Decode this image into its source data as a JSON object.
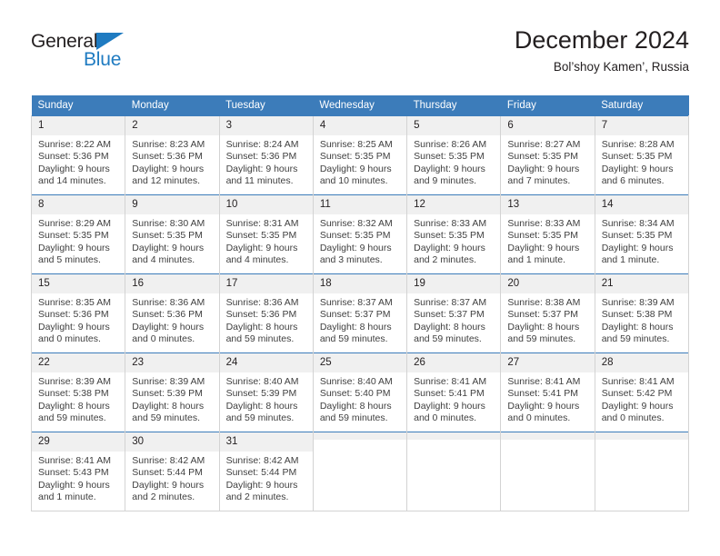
{
  "brand": {
    "name_part1": "General",
    "name_part2": "Blue",
    "triangle_icon": "triangle-logo-mark",
    "accent_color": "#1f7bc1",
    "text_color": "#231f20"
  },
  "header": {
    "title": "December 2024",
    "subtitle": "Bol’shoy Kamen’, Russia"
  },
  "calendar": {
    "header_color": "#3c7cba",
    "daynum_band_color": "#f0f0f0",
    "weekday_names": [
      "Sunday",
      "Monday",
      "Tuesday",
      "Wednesday",
      "Thursday",
      "Friday",
      "Saturday"
    ],
    "weeks": [
      [
        {
          "day": "1",
          "sunrise": "Sunrise: 8:22 AM",
          "sunset": "Sunset: 5:36 PM",
          "daylight_line1": "Daylight: 9 hours",
          "daylight_line2": "and 14 minutes."
        },
        {
          "day": "2",
          "sunrise": "Sunrise: 8:23 AM",
          "sunset": "Sunset: 5:36 PM",
          "daylight_line1": "Daylight: 9 hours",
          "daylight_line2": "and 12 minutes."
        },
        {
          "day": "3",
          "sunrise": "Sunrise: 8:24 AM",
          "sunset": "Sunset: 5:36 PM",
          "daylight_line1": "Daylight: 9 hours",
          "daylight_line2": "and 11 minutes."
        },
        {
          "day": "4",
          "sunrise": "Sunrise: 8:25 AM",
          "sunset": "Sunset: 5:35 PM",
          "daylight_line1": "Daylight: 9 hours",
          "daylight_line2": "and 10 minutes."
        },
        {
          "day": "5",
          "sunrise": "Sunrise: 8:26 AM",
          "sunset": "Sunset: 5:35 PM",
          "daylight_line1": "Daylight: 9 hours",
          "daylight_line2": "and 9 minutes."
        },
        {
          "day": "6",
          "sunrise": "Sunrise: 8:27 AM",
          "sunset": "Sunset: 5:35 PM",
          "daylight_line1": "Daylight: 9 hours",
          "daylight_line2": "and 7 minutes."
        },
        {
          "day": "7",
          "sunrise": "Sunrise: 8:28 AM",
          "sunset": "Sunset: 5:35 PM",
          "daylight_line1": "Daylight: 9 hours",
          "daylight_line2": "and 6 minutes."
        }
      ],
      [
        {
          "day": "8",
          "sunrise": "Sunrise: 8:29 AM",
          "sunset": "Sunset: 5:35 PM",
          "daylight_line1": "Daylight: 9 hours",
          "daylight_line2": "and 5 minutes."
        },
        {
          "day": "9",
          "sunrise": "Sunrise: 8:30 AM",
          "sunset": "Sunset: 5:35 PM",
          "daylight_line1": "Daylight: 9 hours",
          "daylight_line2": "and 4 minutes."
        },
        {
          "day": "10",
          "sunrise": "Sunrise: 8:31 AM",
          "sunset": "Sunset: 5:35 PM",
          "daylight_line1": "Daylight: 9 hours",
          "daylight_line2": "and 4 minutes."
        },
        {
          "day": "11",
          "sunrise": "Sunrise: 8:32 AM",
          "sunset": "Sunset: 5:35 PM",
          "daylight_line1": "Daylight: 9 hours",
          "daylight_line2": "and 3 minutes."
        },
        {
          "day": "12",
          "sunrise": "Sunrise: 8:33 AM",
          "sunset": "Sunset: 5:35 PM",
          "daylight_line1": "Daylight: 9 hours",
          "daylight_line2": "and 2 minutes."
        },
        {
          "day": "13",
          "sunrise": "Sunrise: 8:33 AM",
          "sunset": "Sunset: 5:35 PM",
          "daylight_line1": "Daylight: 9 hours",
          "daylight_line2": "and 1 minute."
        },
        {
          "day": "14",
          "sunrise": "Sunrise: 8:34 AM",
          "sunset": "Sunset: 5:35 PM",
          "daylight_line1": "Daylight: 9 hours",
          "daylight_line2": "and 1 minute."
        }
      ],
      [
        {
          "day": "15",
          "sunrise": "Sunrise: 8:35 AM",
          "sunset": "Sunset: 5:36 PM",
          "daylight_line1": "Daylight: 9 hours",
          "daylight_line2": "and 0 minutes."
        },
        {
          "day": "16",
          "sunrise": "Sunrise: 8:36 AM",
          "sunset": "Sunset: 5:36 PM",
          "daylight_line1": "Daylight: 9 hours",
          "daylight_line2": "and 0 minutes."
        },
        {
          "day": "17",
          "sunrise": "Sunrise: 8:36 AM",
          "sunset": "Sunset: 5:36 PM",
          "daylight_line1": "Daylight: 8 hours",
          "daylight_line2": "and 59 minutes."
        },
        {
          "day": "18",
          "sunrise": "Sunrise: 8:37 AM",
          "sunset": "Sunset: 5:37 PM",
          "daylight_line1": "Daylight: 8 hours",
          "daylight_line2": "and 59 minutes."
        },
        {
          "day": "19",
          "sunrise": "Sunrise: 8:37 AM",
          "sunset": "Sunset: 5:37 PM",
          "daylight_line1": "Daylight: 8 hours",
          "daylight_line2": "and 59 minutes."
        },
        {
          "day": "20",
          "sunrise": "Sunrise: 8:38 AM",
          "sunset": "Sunset: 5:37 PM",
          "daylight_line1": "Daylight: 8 hours",
          "daylight_line2": "and 59 minutes."
        },
        {
          "day": "21",
          "sunrise": "Sunrise: 8:39 AM",
          "sunset": "Sunset: 5:38 PM",
          "daylight_line1": "Daylight: 8 hours",
          "daylight_line2": "and 59 minutes."
        }
      ],
      [
        {
          "day": "22",
          "sunrise": "Sunrise: 8:39 AM",
          "sunset": "Sunset: 5:38 PM",
          "daylight_line1": "Daylight: 8 hours",
          "daylight_line2": "and 59 minutes."
        },
        {
          "day": "23",
          "sunrise": "Sunrise: 8:39 AM",
          "sunset": "Sunset: 5:39 PM",
          "daylight_line1": "Daylight: 8 hours",
          "daylight_line2": "and 59 minutes."
        },
        {
          "day": "24",
          "sunrise": "Sunrise: 8:40 AM",
          "sunset": "Sunset: 5:39 PM",
          "daylight_line1": "Daylight: 8 hours",
          "daylight_line2": "and 59 minutes."
        },
        {
          "day": "25",
          "sunrise": "Sunrise: 8:40 AM",
          "sunset": "Sunset: 5:40 PM",
          "daylight_line1": "Daylight: 8 hours",
          "daylight_line2": "and 59 minutes."
        },
        {
          "day": "26",
          "sunrise": "Sunrise: 8:41 AM",
          "sunset": "Sunset: 5:41 PM",
          "daylight_line1": "Daylight: 9 hours",
          "daylight_line2": "and 0 minutes."
        },
        {
          "day": "27",
          "sunrise": "Sunrise: 8:41 AM",
          "sunset": "Sunset: 5:41 PM",
          "daylight_line1": "Daylight: 9 hours",
          "daylight_line2": "and 0 minutes."
        },
        {
          "day": "28",
          "sunrise": "Sunrise: 8:41 AM",
          "sunset": "Sunset: 5:42 PM",
          "daylight_line1": "Daylight: 9 hours",
          "daylight_line2": "and 0 minutes."
        }
      ],
      [
        {
          "day": "29",
          "sunrise": "Sunrise: 8:41 AM",
          "sunset": "Sunset: 5:43 PM",
          "daylight_line1": "Daylight: 9 hours",
          "daylight_line2": "and 1 minute."
        },
        {
          "day": "30",
          "sunrise": "Sunrise: 8:42 AM",
          "sunset": "Sunset: 5:44 PM",
          "daylight_line1": "Daylight: 9 hours",
          "daylight_line2": "and 2 minutes."
        },
        {
          "day": "31",
          "sunrise": "Sunrise: 8:42 AM",
          "sunset": "Sunset: 5:44 PM",
          "daylight_line1": "Daylight: 9 hours",
          "daylight_line2": "and 2 minutes."
        },
        {
          "day": "",
          "sunrise": "",
          "sunset": "",
          "daylight_line1": "",
          "daylight_line2": ""
        },
        {
          "day": "",
          "sunrise": "",
          "sunset": "",
          "daylight_line1": "",
          "daylight_line2": ""
        },
        {
          "day": "",
          "sunrise": "",
          "sunset": "",
          "daylight_line1": "",
          "daylight_line2": ""
        },
        {
          "day": "",
          "sunrise": "",
          "sunset": "",
          "daylight_line1": "",
          "daylight_line2": ""
        }
      ]
    ]
  }
}
